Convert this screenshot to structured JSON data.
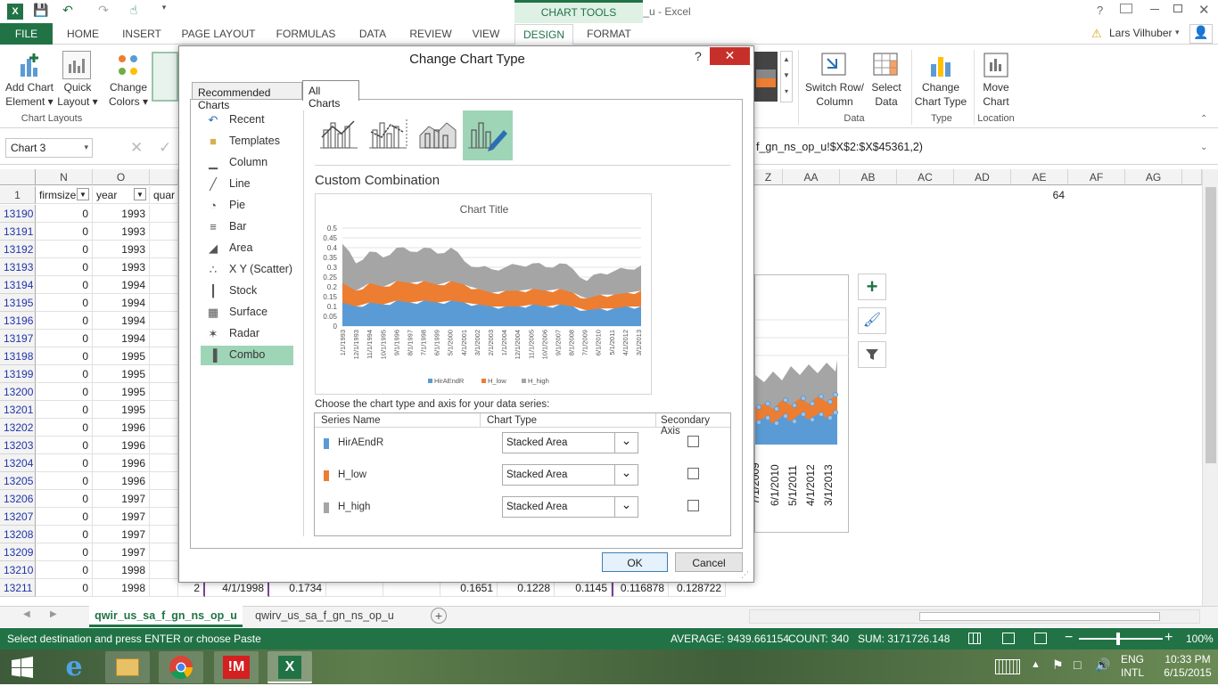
{
  "window": {
    "title": "qwir_us_sa_f_gn_ns_op_u - Excel",
    "chart_tools": "CHART TOOLS",
    "help": "?"
  },
  "tabs": [
    "HOME",
    "INSERT",
    "PAGE LAYOUT",
    "FORMULAS",
    "DATA",
    "REVIEW",
    "VIEW",
    "DESIGN",
    "FORMAT"
  ],
  "file_tab": "FILE",
  "user": "Lars Vilhuber",
  "ribbon": {
    "add_chart_element": [
      "Add Chart",
      "Element ▾"
    ],
    "quick_layout": [
      "Quick",
      "Layout ▾"
    ],
    "change_colors": [
      "Change",
      "Colors ▾"
    ],
    "group_chart_layouts": "Chart Layouts",
    "switch_row_col": [
      "Switch Row/",
      "Column"
    ],
    "select_data": [
      "Select",
      "Data"
    ],
    "group_data": "Data",
    "change_chart_type": [
      "Change",
      "Chart Type"
    ],
    "group_type": "Type",
    "move_chart": [
      "Move",
      "Chart"
    ],
    "group_location": "Location"
  },
  "namebox": "Chart 3",
  "formula": "f_gn_ns_op_u!$X$2:$X$45361,2)",
  "columns_left": [
    "N",
    "O"
  ],
  "columns_right": [
    "AA",
    "AB",
    "AC",
    "AD",
    "AE",
    "AF",
    "AG"
  ],
  "col_z": "Z",
  "header_row": {
    "num": "1",
    "n": "firmsize",
    "o": "year",
    "p": "quar",
    "ae": "64"
  },
  "rows": [
    {
      "num": "13190",
      "n": "0",
      "o": "1993"
    },
    {
      "num": "13191",
      "n": "0",
      "o": "1993"
    },
    {
      "num": "13192",
      "n": "0",
      "o": "1993"
    },
    {
      "num": "13193",
      "n": "0",
      "o": "1993"
    },
    {
      "num": "13194",
      "n": "0",
      "o": "1994"
    },
    {
      "num": "13195",
      "n": "0",
      "o": "1994"
    },
    {
      "num": "13196",
      "n": "0",
      "o": "1994"
    },
    {
      "num": "13197",
      "n": "0",
      "o": "1994"
    },
    {
      "num": "13198",
      "n": "0",
      "o": "1995"
    },
    {
      "num": "13199",
      "n": "0",
      "o": "1995"
    },
    {
      "num": "13200",
      "n": "0",
      "o": "1995"
    },
    {
      "num": "13201",
      "n": "0",
      "o": "1995"
    },
    {
      "num": "13202",
      "n": "0",
      "o": "1996"
    },
    {
      "num": "13203",
      "n": "0",
      "o": "1996"
    },
    {
      "num": "13204",
      "n": "0",
      "o": "1996"
    },
    {
      "num": "13205",
      "n": "0",
      "o": "1996"
    },
    {
      "num": "13206",
      "n": "0",
      "o": "1997"
    },
    {
      "num": "13207",
      "n": "0",
      "o": "1997"
    },
    {
      "num": "13208",
      "n": "0",
      "o": "1997"
    },
    {
      "num": "13209",
      "n": "0",
      "o": "1997"
    },
    {
      "num": "13210",
      "n": "0",
      "o": "1998"
    },
    {
      "num": "13211",
      "n": "0",
      "o": "1998"
    }
  ],
  "row_13211_extra": {
    "p": "2",
    "date": "4/1/1998",
    "v1": "0.1734",
    "v2": "0.1651",
    "v3": "0.1228",
    "v4": "0.1145",
    "v5": "0.116878",
    "v6": "0.128722"
  },
  "bg_chart_dates": [
    "7/1/2009",
    "6/1/2010",
    "5/1/2011",
    "4/1/2012",
    "3/1/2013"
  ],
  "sheets": [
    "qwir_us_sa_f_gn_ns_op_u",
    "qwirv_us_sa_f_gn_ns_op_u"
  ],
  "status": {
    "message": "Select destination and press ENTER or choose Paste",
    "average": "AVERAGE: 9439.661154",
    "count": "COUNT: 340",
    "sum": "SUM: 3171726.148",
    "zoom": "100%"
  },
  "clock": {
    "lang": "ENG",
    "layout": "INTL",
    "time": "10:33 PM",
    "date": "6/15/2015"
  },
  "dialog": {
    "title": "Change Chart Type",
    "help": "?",
    "tab_recommended": "Recommended Charts",
    "tab_all": "All Charts",
    "categories": [
      "Recent",
      "Templates",
      "Column",
      "Line",
      "Pie",
      "Bar",
      "Area",
      "X Y (Scatter)",
      "Stock",
      "Surface",
      "Radar",
      "Combo"
    ],
    "category_icons": [
      "recent-icon",
      "templates-icon",
      "column-chart-icon",
      "line-chart-icon",
      "pie-chart-icon",
      "bar-chart-icon",
      "area-chart-icon",
      "scatter-chart-icon",
      "stock-chart-icon",
      "surface-chart-icon",
      "radar-chart-icon",
      "combo-chart-icon"
    ],
    "section_title": "Custom Combination",
    "instruction": "Choose the chart type and axis for your data series:",
    "table_headers": {
      "name": "Series Name",
      "type": "Chart Type",
      "secondary": "Secondary Axis"
    },
    "series": [
      {
        "name": "HirAEndR",
        "type": "Stacked Area",
        "color": "#5b9bd5",
        "secondary": false
      },
      {
        "name": "H_low",
        "type": "Stacked Area",
        "color": "#ed7d31",
        "secondary": false
      },
      {
        "name": "H_high",
        "type": "Stacked Area",
        "color": "#a5a5a5",
        "secondary": false
      }
    ],
    "ok": "OK",
    "cancel": "Cancel"
  },
  "chart_data": {
    "type": "area",
    "stacked": true,
    "title": "Chart Title",
    "ylim": [
      0,
      0.5
    ],
    "yticks": [
      "0",
      "0.05",
      "0.1",
      "0.15",
      "0.2",
      "0.25",
      "0.3",
      "0.35",
      "0.4",
      "0.45",
      "0.5"
    ],
    "x_tick_labels": [
      "1/1/1993",
      "12/1/1993",
      "11/1/1994",
      "10/1/1995",
      "9/1/1996",
      "8/1/1997",
      "7/1/1998",
      "6/1/1999",
      "5/1/2000",
      "4/1/2001",
      "3/1/2002",
      "2/1/2003",
      "1/1/2004",
      "12/1/2004",
      "11/1/2005",
      "10/1/2006",
      "9/1/2007",
      "8/1/2008",
      "7/1/2009",
      "6/1/2010",
      "5/1/2011",
      "4/1/2012",
      "3/1/2013"
    ],
    "legend": "bottom",
    "series": [
      {
        "name": "HirAEndR",
        "values": [
          0.12,
          0.1,
          0.12,
          0.11,
          0.13,
          0.12,
          0.13,
          0.12,
          0.13,
          0.12,
          0.11,
          0.1,
          0.1,
          0.1,
          0.11,
          0.1,
          0.11,
          0.1,
          0.08,
          0.09,
          0.09,
          0.1,
          0.1
        ]
      },
      {
        "name": "H_low",
        "values": [
          0.1,
          0.08,
          0.1,
          0.09,
          0.1,
          0.1,
          0.1,
          0.09,
          0.1,
          0.09,
          0.08,
          0.07,
          0.08,
          0.08,
          0.08,
          0.08,
          0.08,
          0.07,
          0.06,
          0.07,
          0.07,
          0.07,
          0.08
        ]
      },
      {
        "name": "H_high",
        "values": [
          0.2,
          0.14,
          0.16,
          0.15,
          0.17,
          0.16,
          0.17,
          0.16,
          0.17,
          0.12,
          0.11,
          0.12,
          0.12,
          0.13,
          0.13,
          0.12,
          0.13,
          0.12,
          0.09,
          0.11,
          0.12,
          0.12,
          0.13
        ]
      }
    ],
    "grid": true
  }
}
